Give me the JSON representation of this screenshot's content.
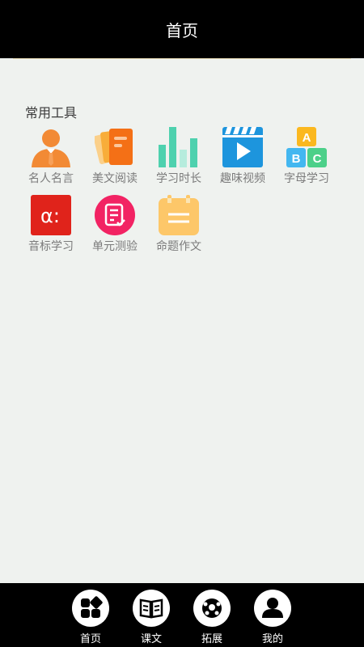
{
  "header": {
    "title": "首页"
  },
  "section": {
    "title": "常用工具"
  },
  "tools": [
    {
      "label": "名人名言",
      "icon": "famous-person-icon"
    },
    {
      "label": "美文阅读",
      "icon": "reading-cards-icon"
    },
    {
      "label": "学习时长",
      "icon": "bar-chart-icon"
    },
    {
      "label": "趣味视频",
      "icon": "video-play-icon"
    },
    {
      "label": "字母学习",
      "icon": "abc-blocks-icon"
    },
    {
      "label": "音标学习",
      "icon": "phonetic-alpha-icon"
    },
    {
      "label": "单元测验",
      "icon": "quiz-document-icon"
    },
    {
      "label": "命题作文",
      "icon": "calendar-note-icon"
    }
  ],
  "bottom_nav": [
    {
      "label": "首页",
      "icon": "home-grid-icon"
    },
    {
      "label": "课文",
      "icon": "book-icon"
    },
    {
      "label": "拓展",
      "icon": "ball-icon"
    },
    {
      "label": "我的",
      "icon": "user-icon"
    }
  ],
  "colors": {
    "header_bg": "#000000",
    "page_bg": "#eff2ef",
    "label_gray": "#7b7b7b"
  }
}
